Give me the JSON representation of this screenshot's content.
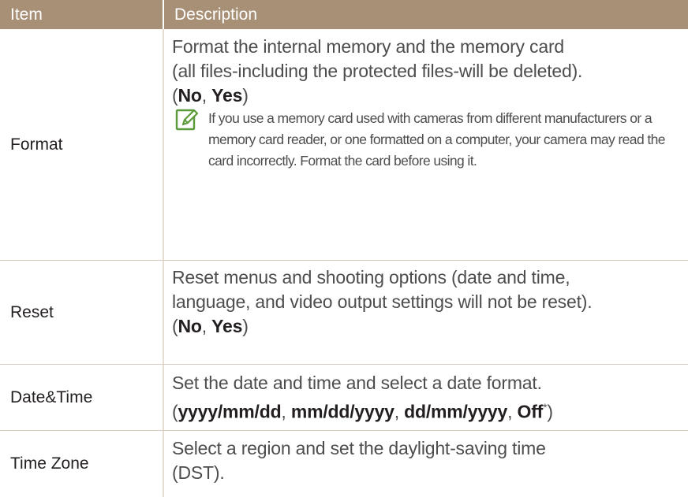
{
  "header": {
    "item": "Item",
    "description": "Description"
  },
  "rows": [
    {
      "item": "Format",
      "desc_line1": "Format the internal memory and the memory card",
      "desc_line2": "(all files-including the protected files-will be deleted).",
      "options": [
        "No",
        "Yes"
      ],
      "note": "If you use a memory card used with cameras from different manufacturers or a memory card reader, or one formatted on a computer, your camera may read the card incorrectly. Format the card before using it."
    },
    {
      "item": "Reset",
      "desc_line1": "Reset menus and shooting options (date and time,",
      "desc_line2": "language, and video output settings will not be reset).",
      "options": [
        "No",
        "Yes"
      ]
    },
    {
      "item": "Date&Time",
      "desc_line1": "Set the date and time and select a date format.",
      "options": [
        "yyyy/mm/dd",
        "mm/dd/yyyy",
        "dd/mm/yyyy",
        "Off"
      ],
      "footnote_mark": "*"
    },
    {
      "item": "Time Zone",
      "desc_line1": "Select a region and set the daylight-saving time",
      "desc_line2": "(DST)."
    }
  ],
  "colors": {
    "header_bg": "#a89077",
    "icon": "#5a9a3b"
  },
  "icons": {
    "note": "note-pencil-icon"
  }
}
